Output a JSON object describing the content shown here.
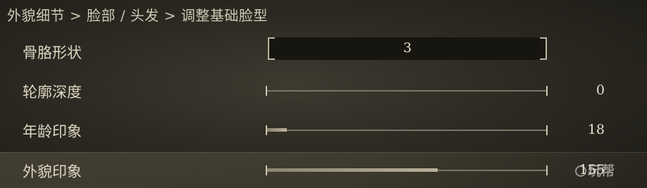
{
  "breadcrumb": "外貌细节 > 脸部 / 头发 > 调整基础脸型",
  "rows": [
    {
      "label": "骨胳形状",
      "control": "select",
      "value": "3"
    },
    {
      "label": "轮廓深度",
      "control": "slider",
      "value": "0",
      "fraction": 0.0
    },
    {
      "label": "年龄印象",
      "control": "slider",
      "value": "18",
      "fraction": 0.07
    },
    {
      "label": "外貌印象",
      "control": "slider",
      "value": "155",
      "fraction": 0.61
    }
  ],
  "selected_row_index": 3,
  "watermark": "玩帮",
  "colors": {
    "background": "#2c2a22",
    "text": "#ddd6c2",
    "track": "#7a7462",
    "frame": "#bdb59d"
  }
}
